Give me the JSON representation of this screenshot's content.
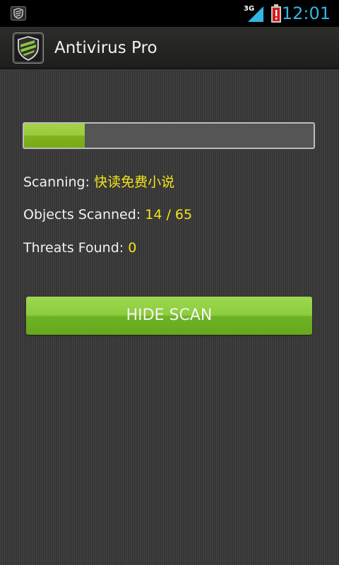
{
  "status_bar": {
    "network_label": "3G",
    "time": "12:01",
    "icons": [
      "app-shield-icon",
      "signal-3g-icon",
      "battery-alert-icon"
    ]
  },
  "app": {
    "title": "Antivirus Pro",
    "icon": "shield-icon"
  },
  "scan": {
    "progress": 0.21,
    "scanning_label": "Scanning: ",
    "scanning_value": "快读免费小说",
    "objects_label": "Objects Scanned: ",
    "objects_value": "14 / 65",
    "threats_label": "Threats Found: ",
    "threats_value": "0",
    "button_label": "HIDE SCAN"
  },
  "colors": {
    "accent_green": "#8dcc3e",
    "value_yellow": "#f2e41a",
    "clock_blue": "#33b5e5"
  }
}
